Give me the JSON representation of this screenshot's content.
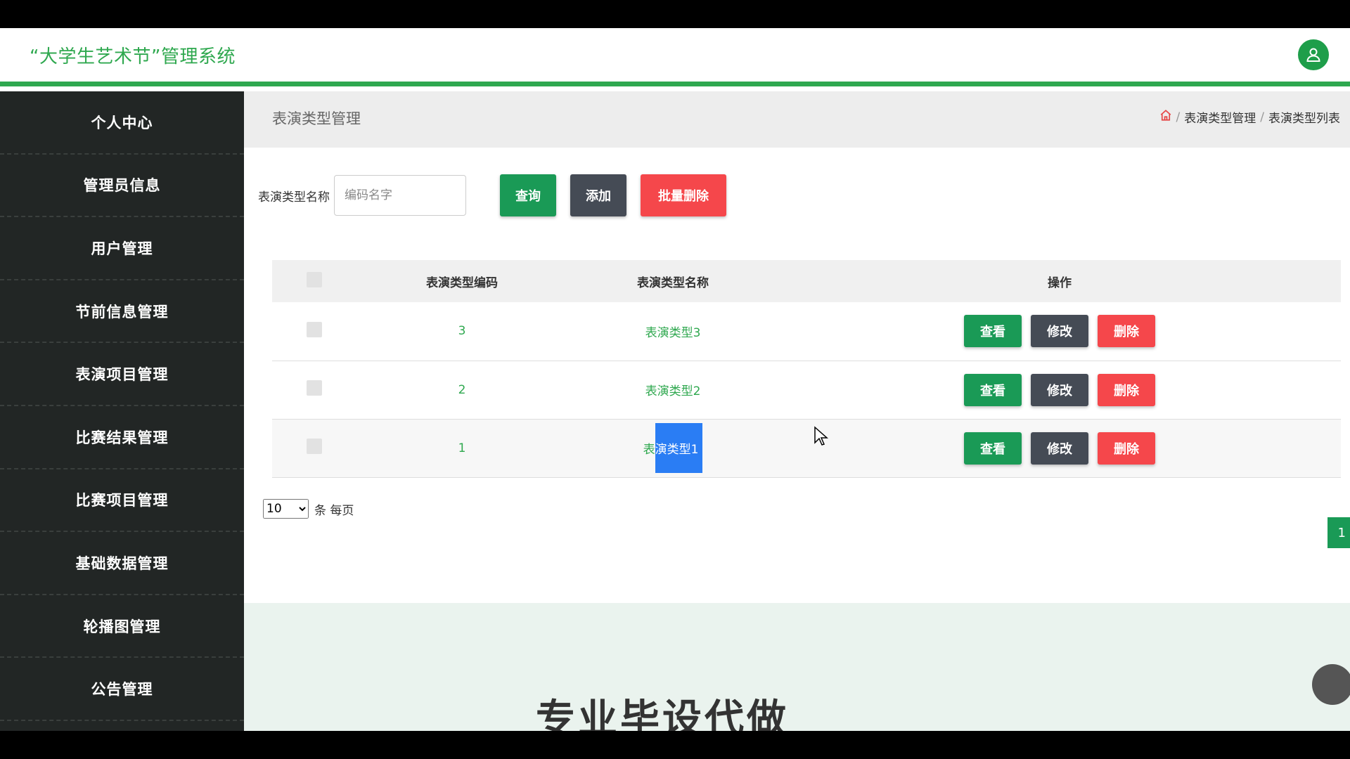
{
  "header": {
    "app_title": "“大学生艺术节”管理系统",
    "avatar_icon": "user-icon",
    "accent": "#2fa84f"
  },
  "sidebar": {
    "items": [
      {
        "label": "个人中心"
      },
      {
        "label": "管理员信息"
      },
      {
        "label": "用户管理"
      },
      {
        "label": "节前信息管理"
      },
      {
        "label": "表演项目管理"
      },
      {
        "label": "比赛结果管理"
      },
      {
        "label": "比赛项目管理"
      },
      {
        "label": "基础数据管理"
      },
      {
        "label": "轮播图管理"
      },
      {
        "label": "公告管理"
      }
    ]
  },
  "page": {
    "title": "表演类型管理",
    "breadcrumb": [
      "表演类型管理",
      "表演类型列表"
    ],
    "breadcrumb_sep": "/"
  },
  "search": {
    "label": "表演类型名称",
    "placeholder": "编码名字",
    "value": "",
    "query_label": "查询",
    "add_label": "添加",
    "batch_delete_label": "批量删除"
  },
  "table": {
    "headers": {
      "code": "表演类型编码",
      "name": "表演类型名称",
      "ops": "操作"
    },
    "rows": [
      {
        "code": "3",
        "name": "表演类型3"
      },
      {
        "code": "2",
        "name": "表演类型2"
      },
      {
        "code": "1",
        "name_a": "表",
        "name_b": "演类型1"
      }
    ],
    "view_label": "查看",
    "edit_label": "修改",
    "delete_label": "删除"
  },
  "pager": {
    "page_size": "10",
    "suffix": "条 每页",
    "current_page": "1"
  },
  "footer": {
    "text": "专业毕设代做"
  }
}
